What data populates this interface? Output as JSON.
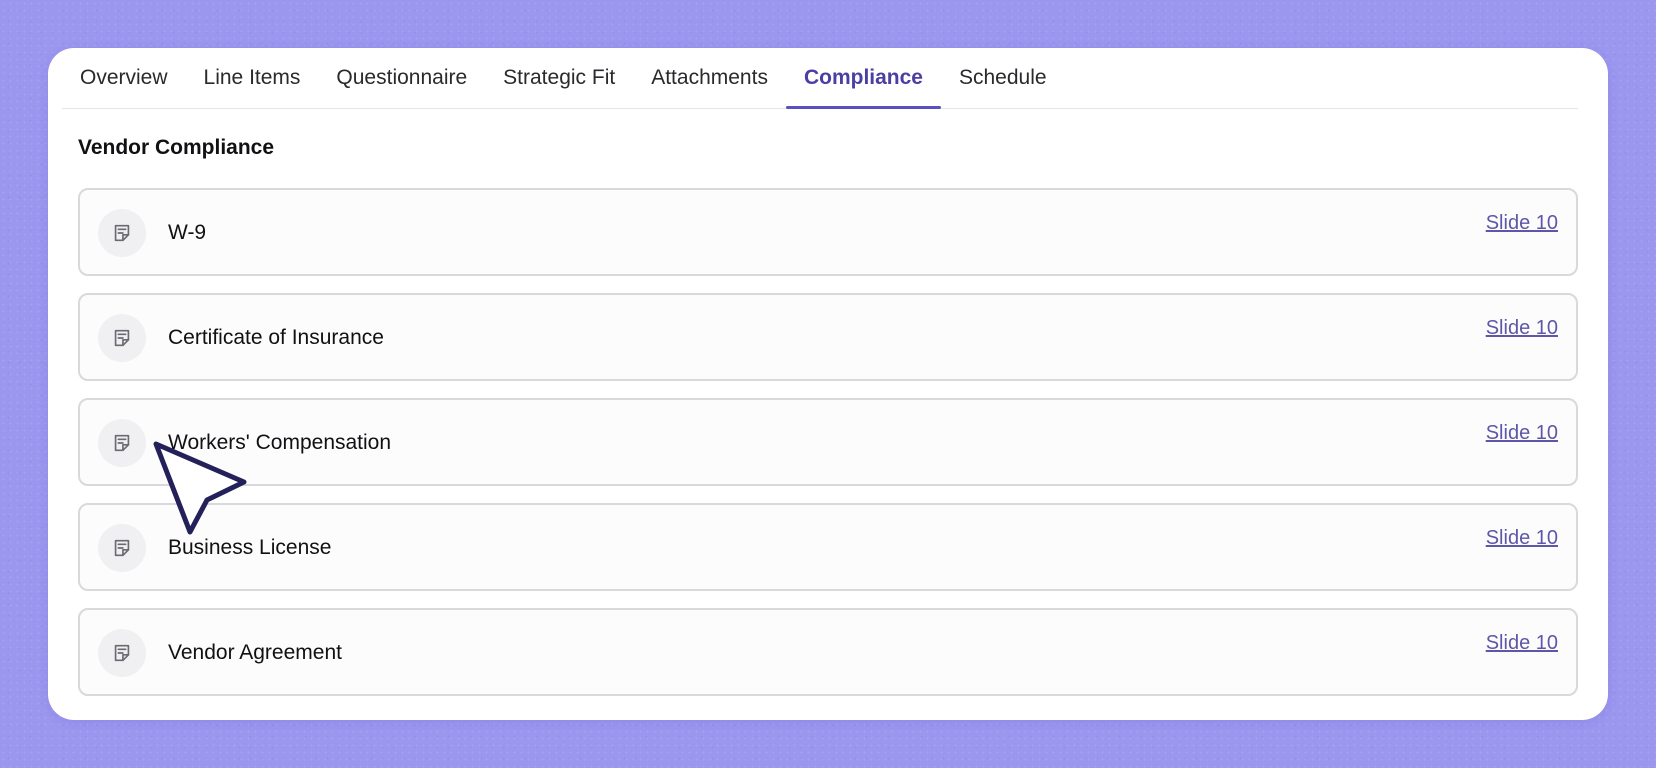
{
  "tabs": [
    {
      "label": "Overview"
    },
    {
      "label": "Line Items"
    },
    {
      "label": "Questionnaire"
    },
    {
      "label": "Strategic Fit"
    },
    {
      "label": "Attachments"
    },
    {
      "label": "Compliance",
      "active": true
    },
    {
      "label": "Schedule"
    }
  ],
  "section": {
    "title": "Vendor Compliance"
  },
  "items": [
    {
      "title": "W-9",
      "link": "Slide 10",
      "icon": "document-icon"
    },
    {
      "title": "Certificate of Insurance",
      "link": "Slide 10",
      "icon": "document-icon"
    },
    {
      "title": "Workers' Compensation",
      "link": "Slide 10",
      "icon": "document-icon"
    },
    {
      "title": "Business License",
      "link": "Slide 10",
      "icon": "document-icon"
    },
    {
      "title": "Vendor Agreement",
      "link": "Slide 10",
      "icon": "document-icon"
    }
  ],
  "colors": {
    "background": "#9b97ef",
    "accent": "#5c4fc2",
    "link": "#5e56a8"
  }
}
